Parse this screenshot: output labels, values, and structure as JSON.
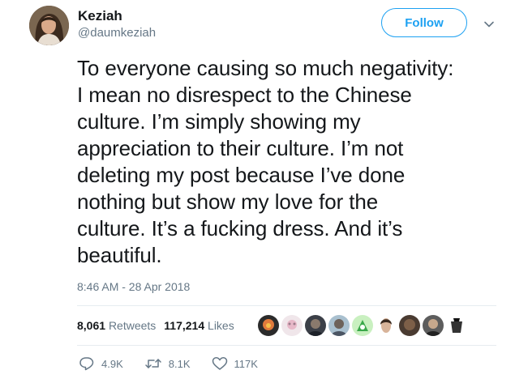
{
  "author": {
    "name": "Keziah",
    "handle": "@daumkeziah"
  },
  "header": {
    "follow_label": "Follow"
  },
  "tweet": {
    "text": "To everyone causing so much negativity:\nI mean no disrespect to the Chinese\nculture. I’m simply showing my\nappreciation to their culture. I’m not\ndeleting my post because I’ve done\nnothing but show my love for the\nculture. It’s a fucking dress. And it’s\nbeautiful.",
    "timestamp": "8:46 AM - 28 Apr 2018"
  },
  "stats": {
    "retweets_count": "8,061",
    "retweets_label": "Retweets",
    "likes_count": "117,214",
    "likes_label": "Likes"
  },
  "actions": {
    "reply_count": "4.9K",
    "retweet_count": "8.1K",
    "like_count": "117K"
  },
  "icons": {
    "reply": "reply-icon",
    "retweet": "retweet-icon",
    "like": "heart-icon",
    "more": "chevron-down-icon"
  },
  "colors": {
    "accent": "#1da1f2",
    "secondary_text": "#657786",
    "primary_text": "#14171a",
    "divider": "#e6ecf0"
  }
}
